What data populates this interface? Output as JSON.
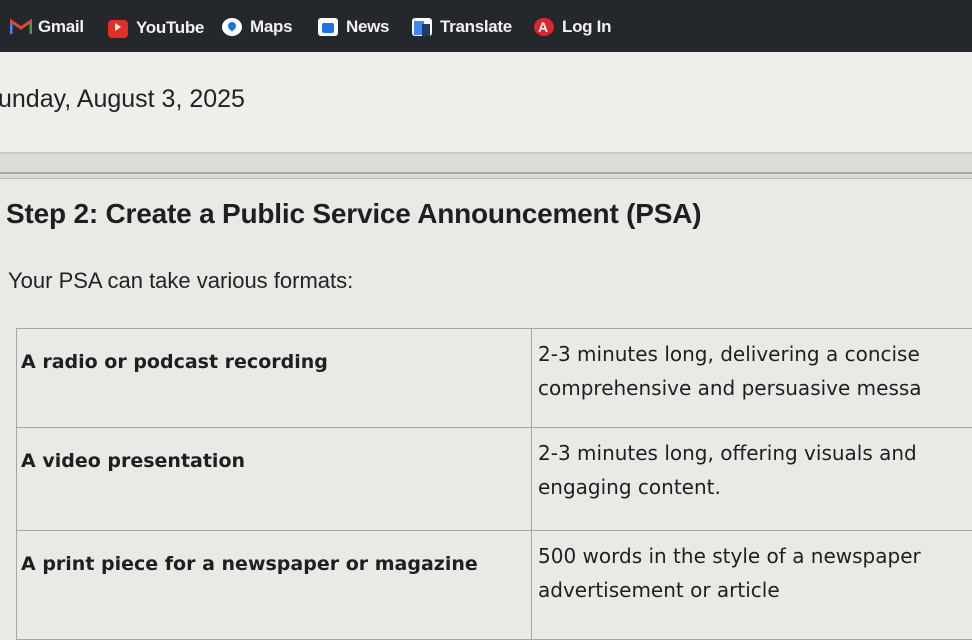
{
  "bookmarks": [
    {
      "label": "Gmail",
      "icon": "gmail-icon"
    },
    {
      "label": "YouTube",
      "icon": "youtube-icon"
    },
    {
      "label": "Maps",
      "icon": "maps-icon"
    },
    {
      "label": "News",
      "icon": "news-icon"
    },
    {
      "label": "Translate",
      "icon": "translate-icon"
    },
    {
      "label": "Log In",
      "icon": "login-icon"
    }
  ],
  "page": {
    "date": "unday, August 3, 2025",
    "step_title": "Step 2: Create a Public Service Announcement (PSA)",
    "intro": "Your PSA can take various formats:"
  },
  "formats_table": {
    "rows": [
      {
        "format": "A radio or podcast recording",
        "desc_line1": "2-3 minutes long, delivering a concise",
        "desc_line2": "comprehensive and persuasive messa"
      },
      {
        "format": "A video presentation",
        "desc_line1": "2-3 minutes long, offering visuals and",
        "desc_line2": "engaging content."
      },
      {
        "format": "A print piece for a newspaper or magazine",
        "desc_line1": "500 words in the style of a newspaper",
        "desc_line2": "advertisement or article"
      }
    ]
  },
  "colors": {
    "bookmark_bar": "#24272c",
    "page_background": "#e9e9e6",
    "youtube_red": "#e52d27",
    "google_blue": "#1a73e8"
  }
}
